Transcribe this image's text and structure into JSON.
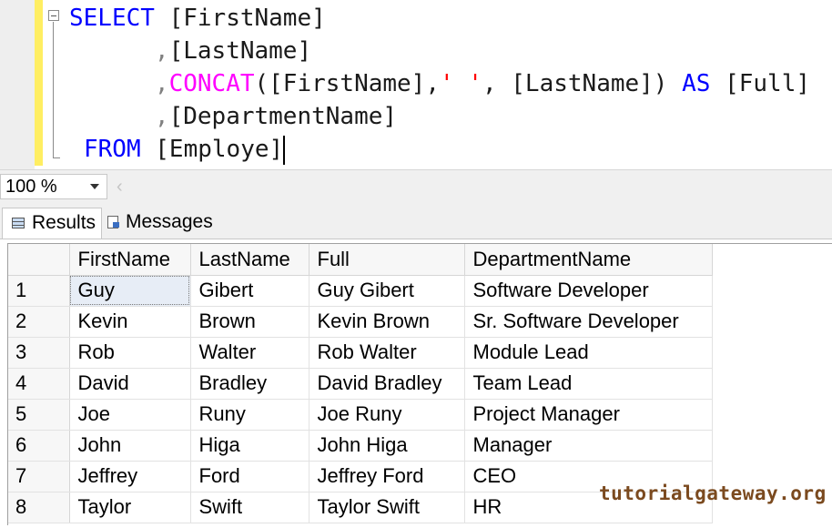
{
  "editor": {
    "lines": [
      {
        "kw": "SELECT",
        "rest": " [FirstName]"
      },
      {
        "text": ",[LastName]"
      },
      {
        "fn": "CONCAT",
        "p1": "([FirstName],",
        "str": "' '",
        "p2": ", [LastName])",
        "as": "AS",
        "alias": "[Full]"
      },
      {
        "text": ",[DepartmentName]"
      },
      {
        "kw": "FROM",
        "rest": " [Employe]"
      }
    ]
  },
  "toolbar": {
    "zoom": "100 %",
    "scroll_left_glyph": "‹"
  },
  "tabs": [
    {
      "label": "Results",
      "icon": "results-grid-icon",
      "active": true
    },
    {
      "label": "Messages",
      "icon": "messages-icon",
      "active": false
    }
  ],
  "results": {
    "columns": [
      "FirstName",
      "LastName",
      "Full",
      "DepartmentName"
    ],
    "rows": [
      [
        "1",
        "Guy",
        "Gibert",
        "Guy Gibert",
        "Software Developer"
      ],
      [
        "2",
        "Kevin",
        "Brown",
        "Kevin Brown",
        "Sr. Software Developer"
      ],
      [
        "3",
        "Rob",
        "Walter",
        "Rob Walter",
        "Module Lead"
      ],
      [
        "4",
        "David",
        "Bradley",
        "David Bradley",
        "Team Lead"
      ],
      [
        "5",
        "Joe",
        "Runy",
        "Joe Runy",
        "Project Manager"
      ],
      [
        "6",
        "John",
        "Higa",
        "John Higa",
        "Manager"
      ],
      [
        "7",
        "Jeffrey",
        "Ford",
        "Jeffrey Ford",
        "CEO"
      ],
      [
        "8",
        "Taylor",
        "Swift",
        "Taylor Swift",
        "HR"
      ]
    ]
  },
  "watermark": "tutorialgateway.org",
  "colors": {
    "keyword": "#0000ff",
    "function": "#ff00ff",
    "string": "#ff0000",
    "change_margin": "#ffee62",
    "selected_cell": "#e7edf6"
  }
}
